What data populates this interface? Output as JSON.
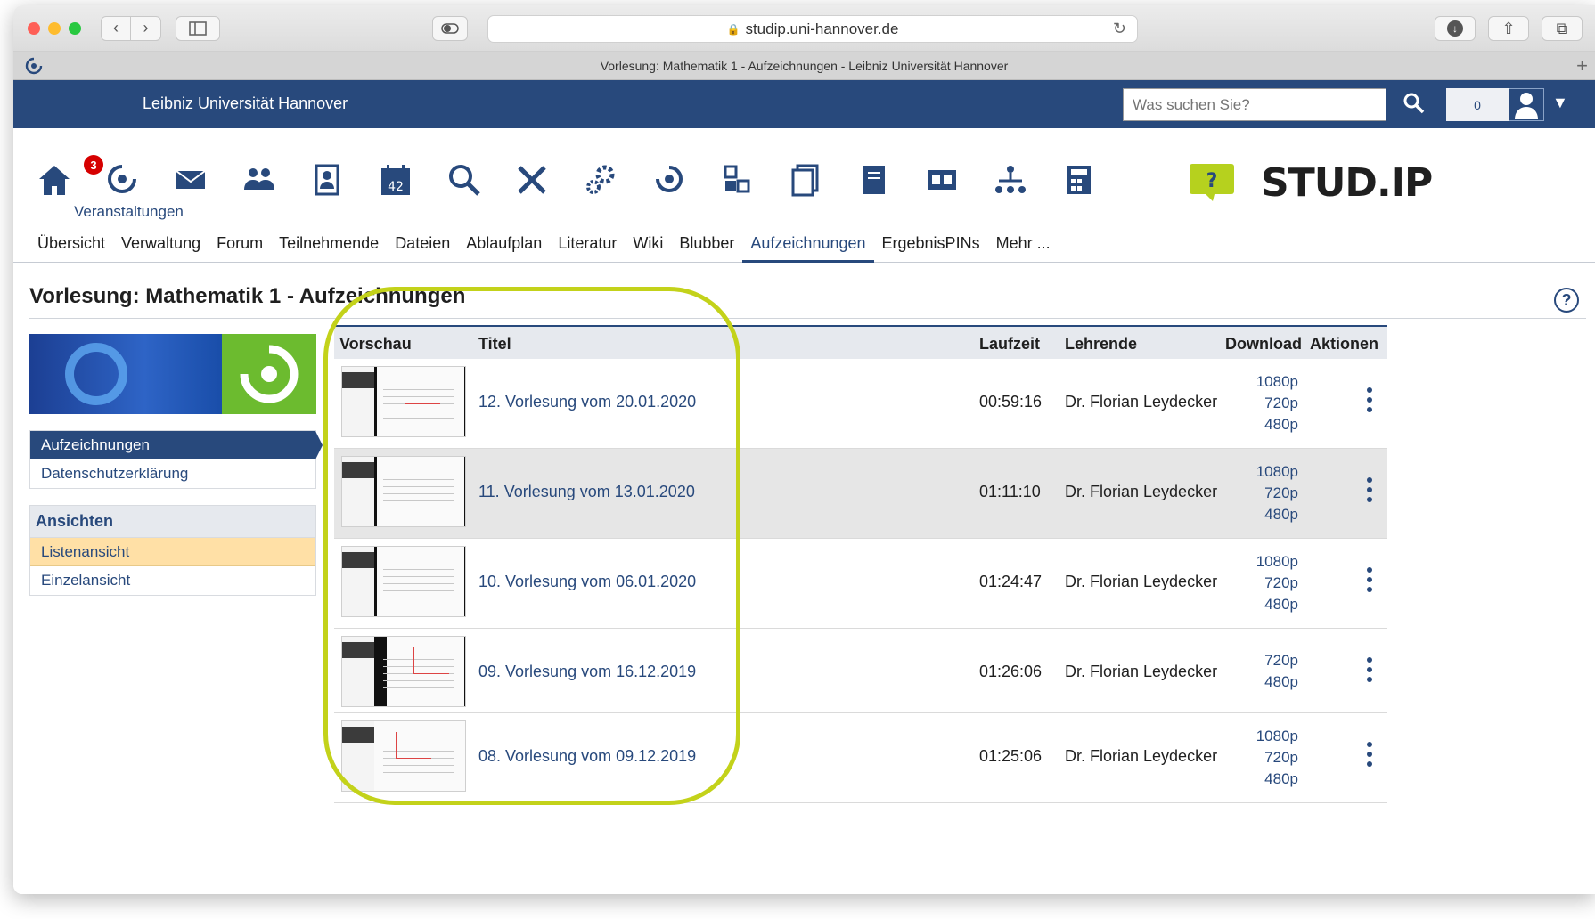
{
  "browser": {
    "url": "studip.uni-hannover.de",
    "tab_title": "Vorlesung: Mathematik 1 - Aufzeichnungen - Leibniz Universität Hannover"
  },
  "header": {
    "uni_name": "Leibniz Universität Hannover",
    "search_placeholder": "Was suchen Sie?",
    "notification_count": "0"
  },
  "iconnav": {
    "badge_count": "3",
    "active_label": "Veranstaltungen",
    "calendar_number": "42",
    "logo_text": "STUD.IP"
  },
  "tabs": [
    {
      "label": "Übersicht"
    },
    {
      "label": "Verwaltung"
    },
    {
      "label": "Forum"
    },
    {
      "label": "Teilnehmende"
    },
    {
      "label": "Dateien"
    },
    {
      "label": "Ablaufplan"
    },
    {
      "label": "Literatur"
    },
    {
      "label": "Wiki"
    },
    {
      "label": "Blubber"
    },
    {
      "label": "Aufzeichnungen",
      "active": true
    },
    {
      "label": "ErgebnisPINs"
    },
    {
      "label": "Mehr ..."
    }
  ],
  "page": {
    "title": "Vorlesung: Mathematik 1 - Aufzeichnungen",
    "help_glyph": "?"
  },
  "sidebar": {
    "nav_items": [
      "Aufzeichnungen",
      "Datenschutzerklärung"
    ],
    "views_heading": "Ansichten",
    "views": [
      "Listenansicht",
      "Einzelansicht"
    ]
  },
  "table": {
    "headers": [
      "Vorschau",
      "Titel",
      "Laufzeit",
      "Lehrende",
      "Download",
      "Aktionen"
    ],
    "rows": [
      {
        "title": "12. Vorlesung vom 20.01.2020",
        "duration": "00:59:16",
        "lecturer": "Dr. Florian Leydecker",
        "downloads": [
          "1080p",
          "720p",
          "480p"
        ]
      },
      {
        "title": "11. Vorlesung vom 13.01.2020",
        "duration": "01:11:10",
        "lecturer": "Dr. Florian Leydecker",
        "downloads": [
          "1080p",
          "720p",
          "480p"
        ]
      },
      {
        "title": "10. Vorlesung vom 06.01.2020",
        "duration": "01:24:47",
        "lecturer": "Dr. Florian Leydecker",
        "downloads": [
          "1080p",
          "720p",
          "480p"
        ]
      },
      {
        "title": "09. Vorlesung vom 16.12.2019",
        "duration": "01:26:06",
        "lecturer": "Dr. Florian Leydecker",
        "downloads": [
          "720p",
          "480p"
        ]
      },
      {
        "title": "08. Vorlesung vom 09.12.2019",
        "duration": "01:25:06",
        "lecturer": "Dr. Florian Leydecker",
        "downloads": [
          "1080p",
          "720p",
          "480p"
        ]
      }
    ]
  },
  "colors": {
    "brand_blue": "#28497c",
    "highlight_ring": "#c3d21a",
    "selected_view": "#ffe0a6"
  },
  "icons": [
    "home-icon",
    "courses-icon",
    "messages-icon",
    "community-icon",
    "profile-icon",
    "schedule-icon",
    "search-icon",
    "tools-icon",
    "admin-icon",
    "opencast-icon",
    "evaluation-icon",
    "files-icon",
    "documents-icon",
    "rooms-icon",
    "hierarchy-icon",
    "calculator-icon",
    "help-icon"
  ]
}
